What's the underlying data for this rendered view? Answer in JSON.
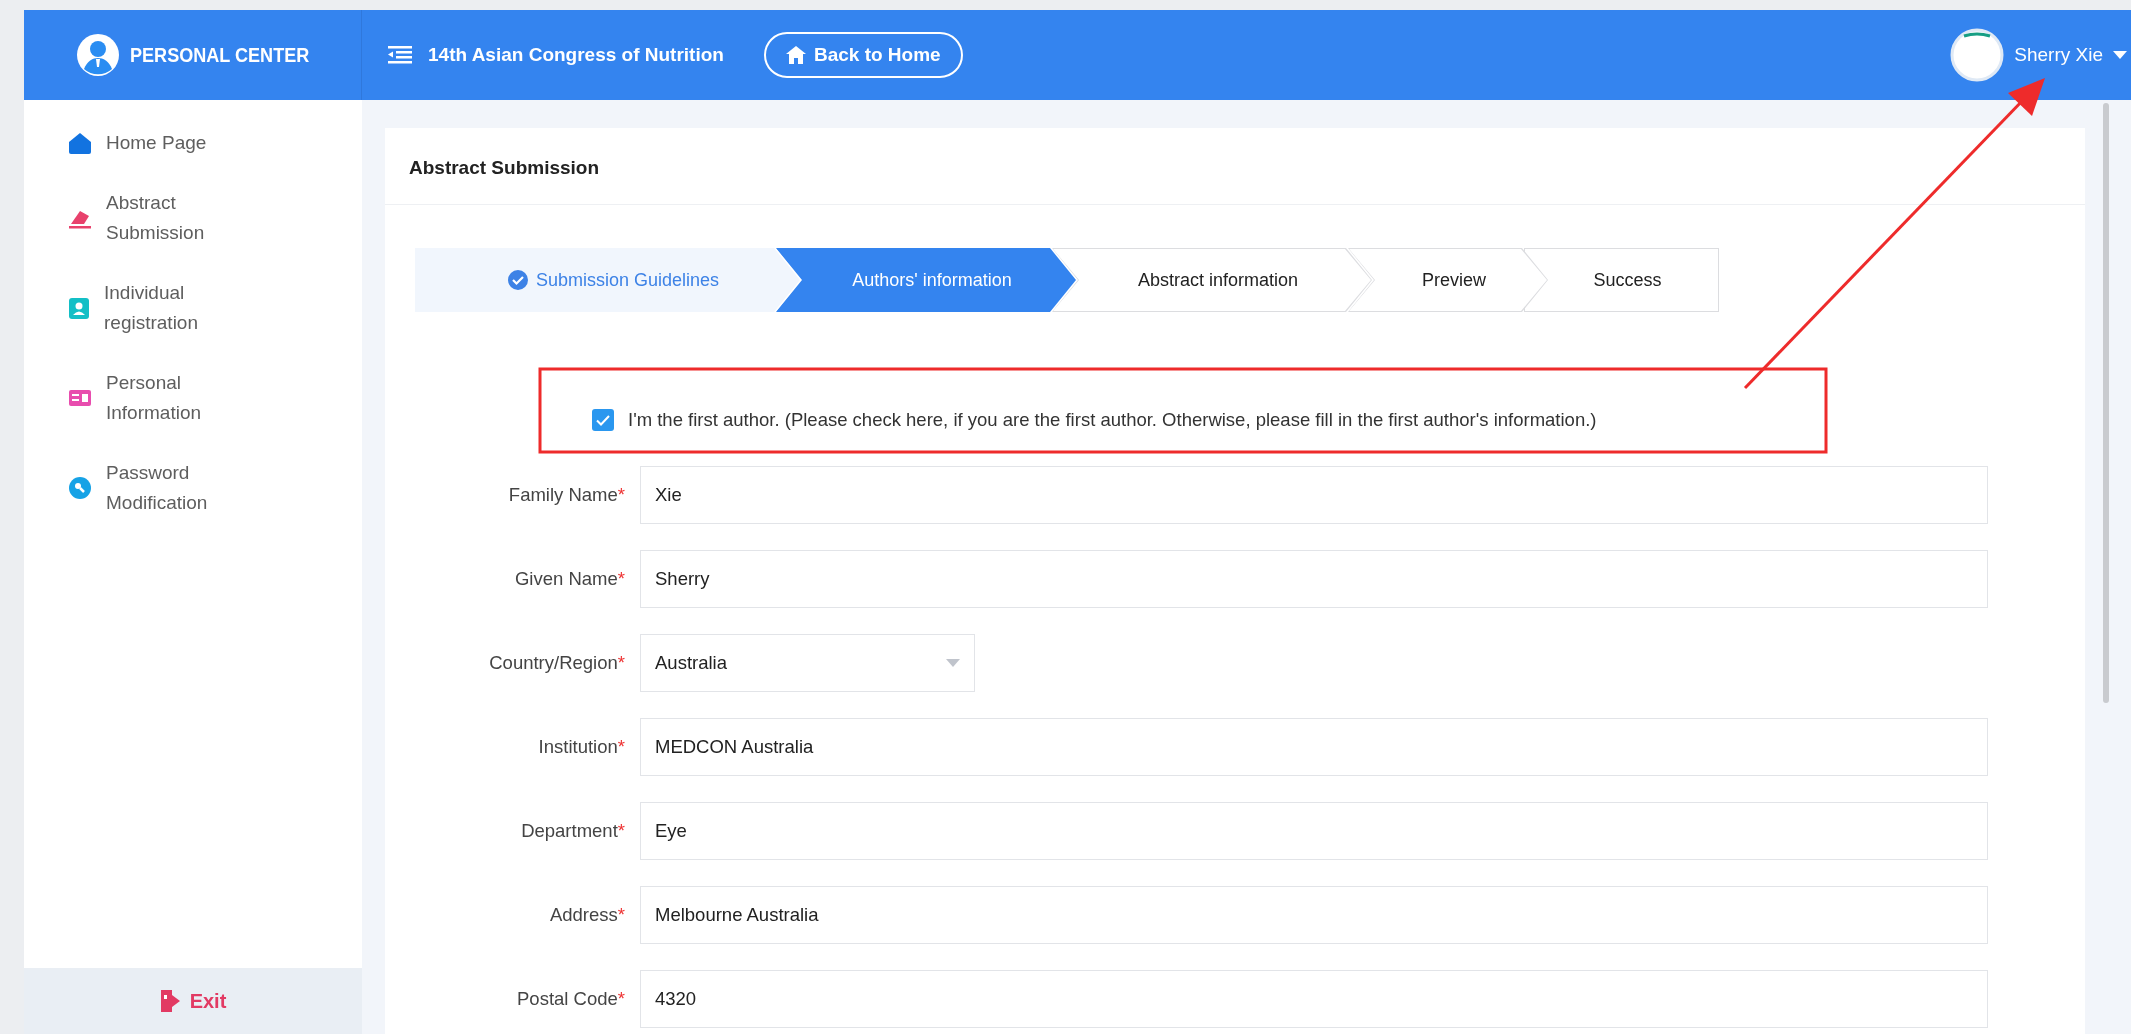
{
  "header": {
    "logo_text": "PERSONAL CENTER",
    "conference": "14th Asian Congress of Nutrition",
    "home_button": "Back to Home",
    "user_name": "Sherry Xie"
  },
  "sidebar": {
    "items": [
      {
        "label": "Home Page",
        "kind": "home"
      },
      {
        "label": "Abstract Submission",
        "kind": "pen"
      },
      {
        "label": "Individual registration",
        "kind": "badge"
      },
      {
        "label": "Personal Information",
        "kind": "card"
      },
      {
        "label": "Password Modification",
        "kind": "key"
      }
    ],
    "exit": "Exit"
  },
  "page_title": "Abstract Submission",
  "steps": [
    {
      "label": "Submission Guidelines",
      "completed": true,
      "selected": false
    },
    {
      "label": "Authors' information",
      "completed": false,
      "selected": true
    },
    {
      "label": "Abstract information",
      "completed": false,
      "selected": false
    },
    {
      "label": "Preview",
      "completed": false,
      "selected": false
    },
    {
      "label": "Success",
      "completed": false,
      "selected": false
    }
  ],
  "first_author": {
    "label": "I'm the first author. (Please check here, if you are the first author. Otherwise, please fill in the first author's information.)",
    "checked": true
  },
  "fields": [
    {
      "label": "Family Name",
      "mark": "*",
      "kind": "text",
      "value": "Xie"
    },
    {
      "label": "Given Name",
      "mark": "*",
      "kind": "text",
      "value": "Sherry"
    },
    {
      "label": "Country/Region",
      "mark": "*",
      "kind": "select",
      "value": "Australia"
    },
    {
      "label": "Institution",
      "mark": "*",
      "kind": "text",
      "value": "MEDCON Australia"
    },
    {
      "label": "Department",
      "mark": "*",
      "kind": "text",
      "value": "Eye"
    },
    {
      "label": "Address",
      "mark": "*",
      "kind": "text",
      "value": "Melbourne Australia"
    },
    {
      "label": "Postal Code",
      "mark": "*",
      "kind": "text",
      "value": "4320"
    }
  ]
}
